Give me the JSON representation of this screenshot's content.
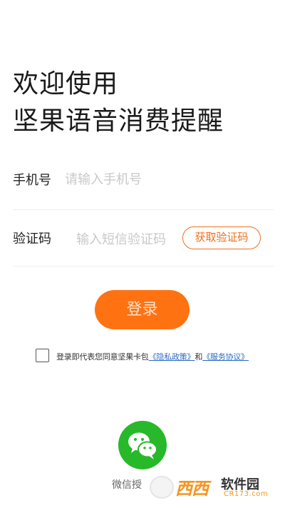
{
  "welcome": {
    "line1": "欢迎使用",
    "line2": "坚果语音消费提醒"
  },
  "phone_field": {
    "label": "手机号",
    "placeholder": "请输入手机号",
    "value": ""
  },
  "code_field": {
    "label": "验证码",
    "placeholder": "输入短信验证码",
    "value": "",
    "get_code_label": "获取验证码"
  },
  "login": {
    "label": "登录"
  },
  "agreement": {
    "checked": false,
    "prefix": "登录即代表您同意坚果卡包",
    "privacy_link": "《隐私政策》",
    "conjunction": "和",
    "service_link": "《服务协议》"
  },
  "wechat": {
    "label": "微信授",
    "icon": "wechat-icon"
  },
  "watermark": {
    "brand": "西西",
    "site": "软件园",
    "url": "CR173.com"
  },
  "colors": {
    "accent": "#ff7212",
    "link": "#2b6cc4",
    "wechat": "#27b92a"
  }
}
